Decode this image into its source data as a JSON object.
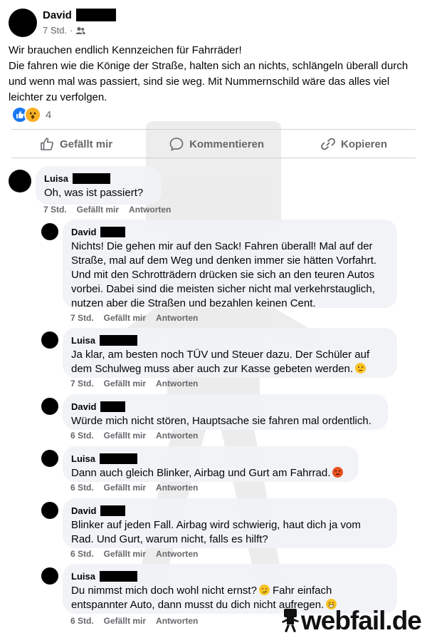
{
  "post": {
    "author": "David",
    "time": "7 Std.",
    "separator": "·",
    "audience_icon": "friends-icon",
    "lines": [
      "Wir brauchen endlich Kennzeichen für Fahrräder!",
      "Die fahren wie die Könige der Straße, halten sich an nichts, schlängeln überall durch",
      "und wenn mal was passiert, sind sie weg. Mit Nummernschild wäre das alles viel",
      "leichter zu verfolgen."
    ],
    "reaction_icons": [
      "like-icon",
      "wow-icon"
    ],
    "reaction_count": "4"
  },
  "actions": {
    "like": "Gefällt mir",
    "comment": "Kommentieren",
    "copy": "Kopieren"
  },
  "comments": [
    {
      "name": "Luisa",
      "lines": [
        "Oh, was ist passiert?"
      ],
      "time": "7 Std.",
      "like": "Gefällt mir",
      "reply": "Antworten"
    },
    {
      "name": "David",
      "lines": [
        "Nichts! Die gehen mir auf den Sack! Fahren überall! Mal auf der",
        "Straße, mal auf dem Weg und denken immer sie hätten Vorfahrt.",
        "Und mit den Schrotträdern drücken sie sich an den teuren Autos",
        "vorbei. Dabei sind die meisten sicher nicht mal verkehrstauglich,",
        "nutzen aber die Straßen und bezahlen keinen Cent."
      ],
      "time": "7 Std.",
      "like": "Gefällt mir",
      "reply": "Antworten"
    },
    {
      "name": "Luisa",
      "lines": [
        "Ja klar, am besten noch TÜV und Steuer dazu. Der Schüler auf",
        "dem Schulweg muss aber auch zur Kasse gebeten werden."
      ],
      "emoji": "thinking-emoji-icon",
      "time": "7 Std.",
      "like": "Gefällt mir",
      "reply": "Antworten"
    },
    {
      "name": "David",
      "lines": [
        "Würde mich nicht stören, Hauptsache sie fahren mal ordentlich."
      ],
      "time": "6 Std.",
      "like": "Gefällt mir",
      "reply": "Antworten"
    },
    {
      "name": "Luisa",
      "lines": [
        "Dann auch gleich Blinker, Airbag und Gurt am Fahrrad."
      ],
      "emoji": "angry-emoji-icon",
      "time": "6 Std.",
      "like": "Gefällt mir",
      "reply": "Antworten"
    },
    {
      "name": "David",
      "lines": [
        "Blinker auf jeden Fall. Airbag wird schwierig, haut dich ja vom",
        "Rad. Und Gurt, warum nicht, falls es hilft?"
      ],
      "time": "6 Std.",
      "like": "Gefällt mir",
      "reply": "Antworten"
    },
    {
      "name": "Luisa",
      "lines_with_emoji": {
        "line1_a": "Du nimmst mich doch wohl nicht ernst?",
        "line1_b": "Fahr einfach",
        "line2": "entspannter Auto, dann musst du dich nicht aufregen."
      },
      "emoji1": "smirk-emoji-icon",
      "emoji2": "grin-emoji-icon",
      "time": "6 Std.",
      "like": "Gefällt mir",
      "reply": "Antworten"
    }
  ],
  "brand": {
    "text": "webfail.de",
    "icon": "webfail-mascot-icon"
  },
  "colors": {
    "meta_text": "#65676b",
    "bubble": "#f0f2f5",
    "like_blue": "#1877f2",
    "wow_yellow": "#f7b125"
  }
}
